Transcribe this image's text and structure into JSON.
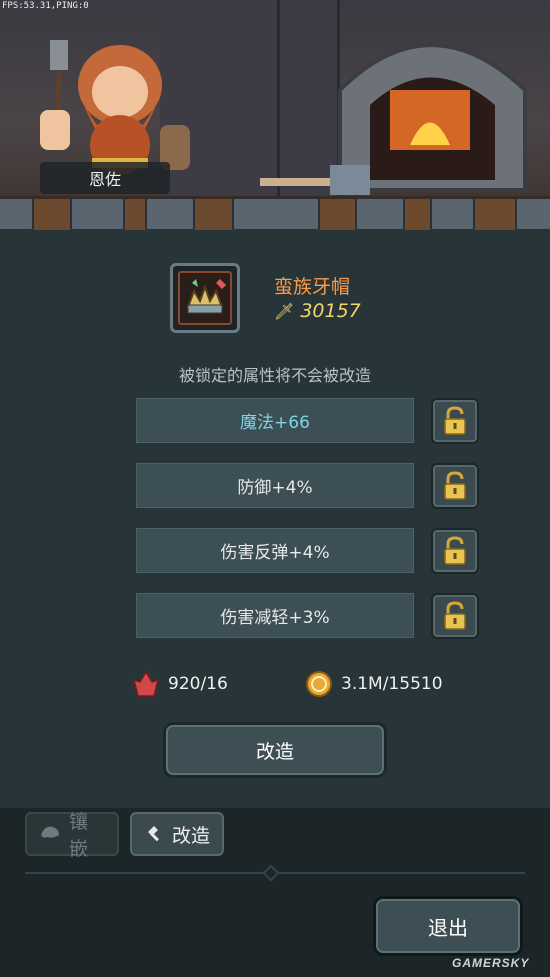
{
  "debug": {
    "fps_text": "FPS:53.31,PING:0"
  },
  "npc": {
    "name": "恩佐",
    "icon": "dwarf-blacksmith-portrait"
  },
  "item": {
    "name": "蛮族牙帽",
    "power": "30157",
    "name_color": "#ff9a4a",
    "power_color": "#f2d56b",
    "icon": "horned-helmet-icon"
  },
  "hint": "被锁定的属性将不会被改造",
  "attributes": [
    {
      "label": "魔法+66",
      "locked": false,
      "highlight": true
    },
    {
      "label": "防御+4%",
      "locked": false,
      "highlight": false
    },
    {
      "label": "伤害反弹+4%",
      "locked": false,
      "highlight": false
    },
    {
      "label": "伤害减轻+3%",
      "locked": false,
      "highlight": false
    }
  ],
  "resources": {
    "crystal": {
      "text": "920/16",
      "icon": "red-crystal-icon"
    },
    "gold": {
      "text": "3.1M/15510",
      "icon": "gold-coin-icon"
    }
  },
  "buttons": {
    "reforge": "改造",
    "exit": "退出"
  },
  "tabs": [
    {
      "label": "镶嵌",
      "icon": "gem-icon",
      "active": false
    },
    {
      "label": "改造",
      "icon": "hammer-icon",
      "active": true
    }
  ],
  "watermark": "GAMERSKY",
  "colors": {
    "panel": "#283538",
    "attr_bg": "#3b4f55",
    "highlight_text": "#7fd4e6"
  }
}
